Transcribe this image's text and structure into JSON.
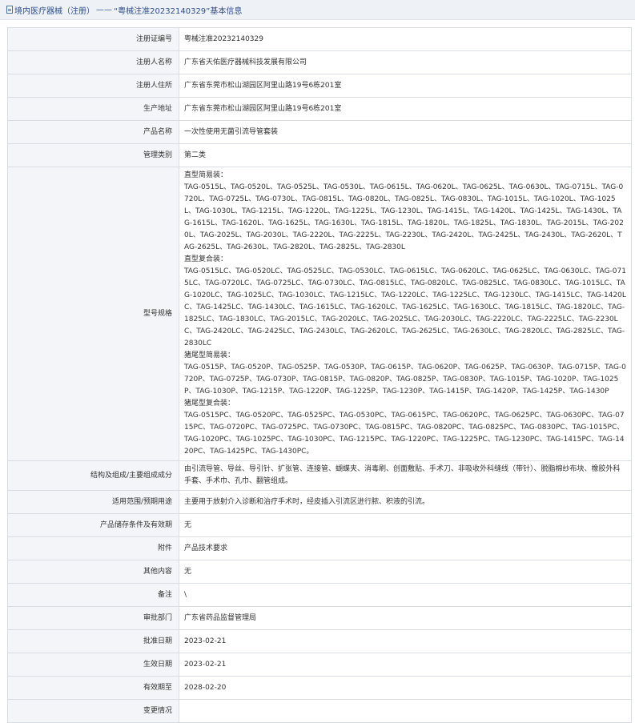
{
  "header": {
    "category": "境内医疗器械（注册）",
    "separator": "——",
    "record_title": "“粤械注准20232140329”基本信息"
  },
  "rows": {
    "reg_no": {
      "label": "注册证编号",
      "value": "粤械注准20232140329"
    },
    "registrant": {
      "label": "注册人名称",
      "value": "广东省天佑医疗器械科技发展有限公司"
    },
    "address": {
      "label": "注册人住所",
      "value": "广东省东莞市松山湖园区阿里山路19号6栋201室"
    },
    "prod_address": {
      "label": "生产地址",
      "value": "广东省东莞市松山湖园区阿里山路19号6栋201室"
    },
    "product_name": {
      "label": "产品名称",
      "value": "一次性使用无菌引流导管套装"
    },
    "mgmt_class": {
      "label": "管理类别",
      "value": "第二类"
    },
    "models": {
      "label": "型号规格",
      "groups": [
        {
          "title": "直型简易装：",
          "items": "TAG-0515L、TAG-0520L、TAG-0525L、TAG-0530L、TAG-0615L、TAG-0620L、TAG-0625L、TAG-0630L、TAG-0715L、TAG-0720L、TAG-0725L、TAG-0730L、TAG-0815L、TAG-0820L、TAG-0825L、TAG-0830L、TAG-1015L、TAG-1020L、TAG-1025L、TAG-1030L、TAG-1215L、TAG-1220L、TAG-1225L、TAG-1230L、TAG-1415L、TAG-1420L、TAG-1425L、TAG-1430L、TAG-1615L、TAG-1620L、TAG-1625L、TAG-1630L、TAG-1815L、TAG-1820L、TAG-1825L、TAG-1830L、TAG-2015L、TAG-2020L、TAG-2025L、TAG-2030L、TAG-2220L、TAG-2225L、TAG-2230L、TAG-2420L、TAG-2425L、TAG-2430L、TAG-2620L、TAG-2625L、TAG-2630L、TAG-2820L、TAG-2825L、TAG-2830L"
        },
        {
          "title": "直型复合装：",
          "items": "TAG-0515LC、TAG-0520LC、TAG-0525LC、TAG-0530LC、TAG-0615LC、TAG-0620LC、TAG-0625LC、TAG-0630LC、TAG-0715LC、TAG-0720LC、TAG-0725LC、TAG-0730LC、TAG-0815LC、TAG-0820LC、TAG-0825LC、TAG-0830LC、TAG-1015LC、TAG-1020LC、TAG-1025LC、TAG-1030LC、TAG-1215LC、TAG-1220LC、TAG-1225LC、TAG-1230LC、TAG-1415LC、TAG-1420LC、TAG-1425LC、TAG-1430LC、TAG-1615LC、TAG-1620LC、TAG-1625LC、TAG-1630LC、TAG-1815LC、TAG-1820LC、TAG-1825LC、TAG-1830LC、TAG-2015LC、TAG-2020LC、TAG-2025LC、TAG-2030LC、TAG-2220LC、TAG-2225LC、TAG-2230LC、TAG-2420LC、TAG-2425LC、TAG-2430LC、TAG-2620LC、TAG-2625LC、TAG-2630LC、TAG-2820LC、TAG-2825LC、TAG-2830LC"
        },
        {
          "title": "猪尾型简易装：",
          "items": "TAG-0515P、TAG-0520P、TAG-0525P、TAG-0530P、TAG-0615P、TAG-0620P、TAG-0625P、TAG-0630P、TAG-0715P、TAG-0720P、TAG-0725P、TAG-0730P、TAG-0815P、TAG-0820P、TAG-0825P、TAG-0830P、TAG-1015P、TAG-1020P、TAG-1025P、TAG-1030P、TAG-1215P、TAG-1220P、TAG-1225P、TAG-1230P、TAG-1415P、TAG-1420P、TAG-1425P、TAG-1430P"
        },
        {
          "title": "猪尾型复合装：",
          "items": "TAG-0515PC、TAG-0520PC、TAG-0525PC、TAG-0530PC、TAG-0615PC、TAG-0620PC、TAG-0625PC、TAG-0630PC、TAG-0715PC、TAG-0720PC、TAG-0725PC、TAG-0730PC、TAG-0815PC、TAG-0820PC、TAG-0825PC、TAG-0830PC、TAG-1015PC、TAG-1020PC、TAG-1025PC、TAG-1030PC、TAG-1215PC、TAG-1220PC、TAG-1225PC、TAG-1230PC、TAG-1415PC、TAG-1420PC、TAG-1425PC、TAG-1430PC。"
        }
      ]
    },
    "composition": {
      "label": "结构及组成/主要组成成分",
      "value": "由引流导管、导丝、导引针、扩张管、连接管、蝴蝶夹、消毒刷、创面敷贴、手术刀、非吸收外科缝线（带针）、脱脂棉纱布块、橡胶外科手套、手术巾、孔巾、翻管组成。"
    },
    "usage": {
      "label": "适用范围/预期用途",
      "value": "主要用于放射介入诊断和治疗手术时，经皮插入引流区进行脓、积液的引流。"
    },
    "storage": {
      "label": "产品储存条件及有效期",
      "value": "无"
    },
    "attachment": {
      "label": "附件",
      "value": "产品技术要求"
    },
    "other": {
      "label": "其他内容",
      "value": "无"
    },
    "remark": {
      "label": "备注",
      "value": "\\"
    },
    "approver": {
      "label": "审批部门",
      "value": "广东省药品监督管理局"
    },
    "approve_date": {
      "label": "批准日期",
      "value": "2023-02-21"
    },
    "effective_date": {
      "label": "生效日期",
      "value": "2023-02-21"
    },
    "expiry": {
      "label": "有效期至",
      "value": "2028-02-20"
    },
    "changes": {
      "label": "变更情况",
      "value": ""
    }
  }
}
